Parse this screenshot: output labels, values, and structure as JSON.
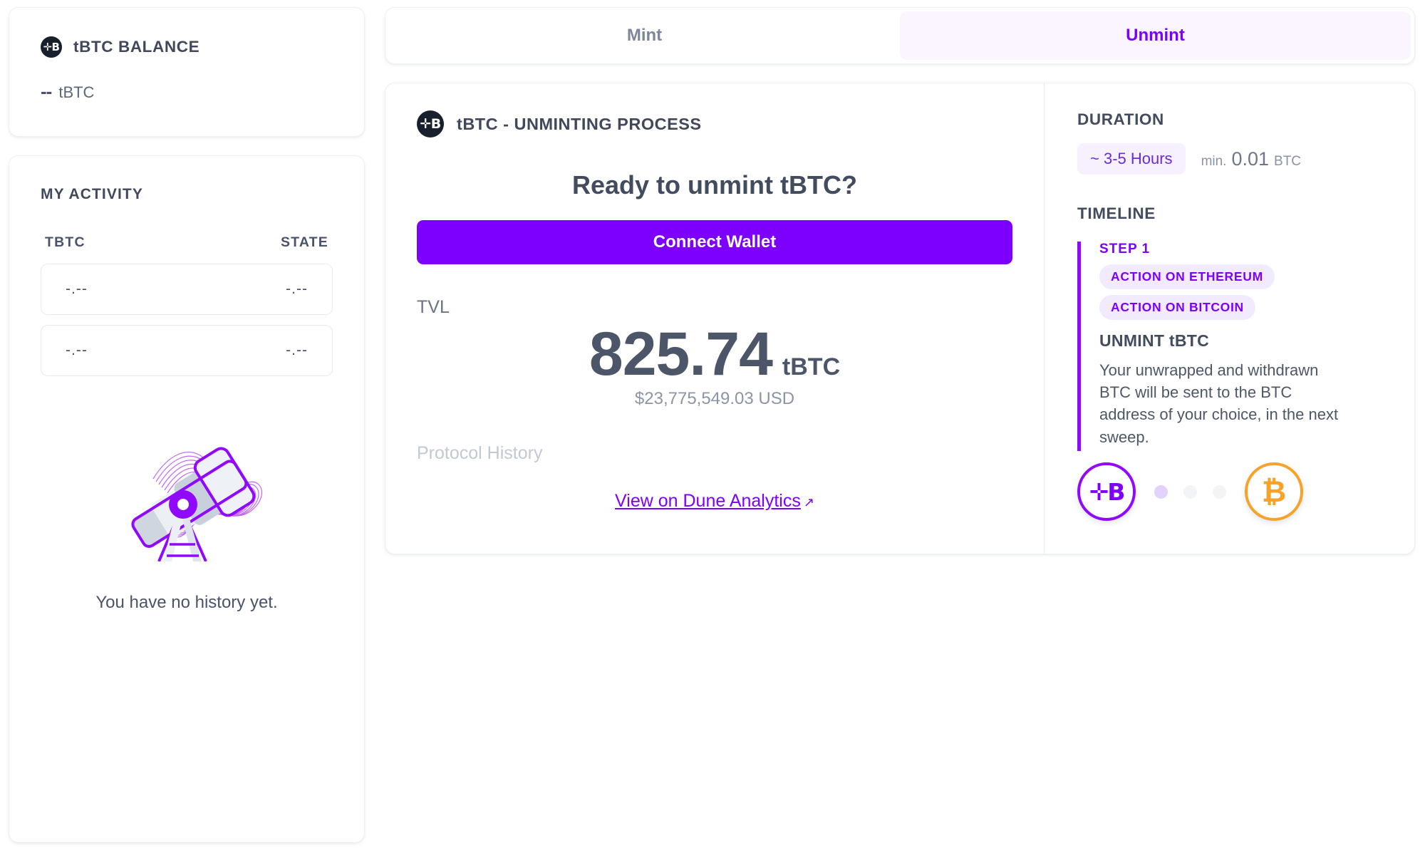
{
  "sidebar": {
    "balance": {
      "icon": "tbtc-coin-icon",
      "title": "tBTC BALANCE",
      "value": "--",
      "unit": "tBTC"
    },
    "activity": {
      "title": "MY ACTIVITY",
      "columns": [
        "TBTC",
        "STATE"
      ],
      "rows": [
        {
          "tbtc": "-.--",
          "state": "-.--"
        },
        {
          "tbtc": "-.--",
          "state": "-.--"
        }
      ],
      "empty_illustration": "telescope-illustration",
      "empty_text": "You have no history yet."
    }
  },
  "main": {
    "tabs": [
      {
        "label": "Mint",
        "active": false
      },
      {
        "label": "Unmint",
        "active": true
      }
    ],
    "process": {
      "icon": "tbtc-coin-icon",
      "title": "tBTC - UNMINTING PROCESS",
      "ready_title": "Ready to unmint tBTC?",
      "connect_label": "Connect Wallet",
      "tvl_label": "TVL",
      "tvl_value": "825.74",
      "tvl_unit": "tBTC",
      "tvl_usd": "$23,775,549.03 USD",
      "protocol_history_label": "Protocol History",
      "dune_link": "View on Dune Analytics",
      "dune_arrow": "↗"
    },
    "info": {
      "duration_label": "DURATION",
      "duration_pill": "~ 3-5 Hours",
      "min_prefix": "min.",
      "min_value": "0.01",
      "min_unit": "BTC",
      "timeline_label": "TIMELINE",
      "step": {
        "number": "STEP 1",
        "chips": [
          "ACTION ON ETHEREUM",
          "ACTION ON BITCOIN"
        ],
        "heading": "UNMINT tBTC",
        "body": "Your unwrapped and withdrawn BTC will be sent to the BTC address of your choice, in the next sweep."
      },
      "coins": {
        "left": "tbtc-coin-icon",
        "left_symbol": "✛B",
        "right": "bitcoin-coin-icon",
        "right_symbol": "₿",
        "dots": [
          "on",
          "off",
          "off"
        ]
      }
    }
  },
  "colors": {
    "accent": "#7D00FF",
    "accent_soft": "#F7F1FF",
    "bitcoin": "#F7A32A",
    "text_dark": "#434C5F",
    "text_muted": "#8C95A5"
  }
}
